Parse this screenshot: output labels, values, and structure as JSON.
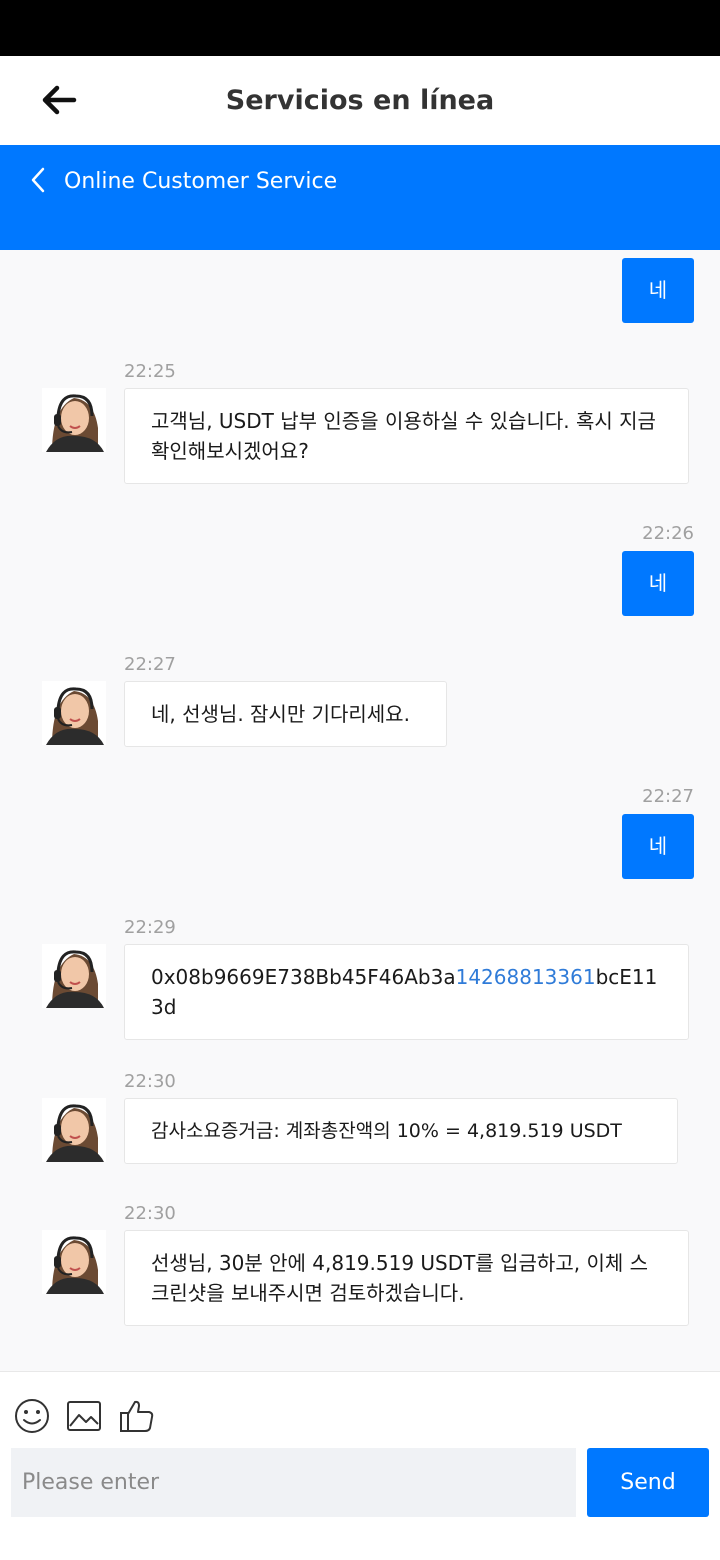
{
  "header": {
    "title": "Servicios en línea"
  },
  "cs_bar": {
    "title": "Online Customer Service"
  },
  "chat": {
    "messages": [
      {
        "side": "out",
        "text": "네"
      },
      {
        "side": "in",
        "time": "22:25",
        "text": "고객님, USDT 납부 인증을 이용하실 수 있습니다. 혹시 지금 확인해보시겠어요?"
      },
      {
        "side": "out",
        "time": "22:26",
        "text": "네"
      },
      {
        "side": "in",
        "time": "22:27",
        "text": "네, 선생님. 잠시만 기다리세요."
      },
      {
        "side": "out",
        "time": "22:27",
        "text": "네"
      },
      {
        "side": "in",
        "time": "22:29",
        "text_prefix": "0x08b9669E738Bb45F46Ab3a",
        "text_link": "14268813361",
        "text_suffix": "bcE113d"
      },
      {
        "side": "in",
        "time": "22:30",
        "text": "감사소요증거금: 계좌총잔액의 10% = 4,819.519 USDT"
      },
      {
        "side": "in",
        "time": "22:30",
        "text": "선생님, 30분 안에 4,819.519 USDT를 입금하고, 이체 스크린샷을 보내주시면 검토하겠습니다."
      }
    ]
  },
  "composer": {
    "placeholder": "Please enter",
    "send_label": "Send"
  },
  "colors": {
    "accent": "#0078ff",
    "link": "#2f7bd8",
    "chat_bg": "#f9f9fa"
  }
}
